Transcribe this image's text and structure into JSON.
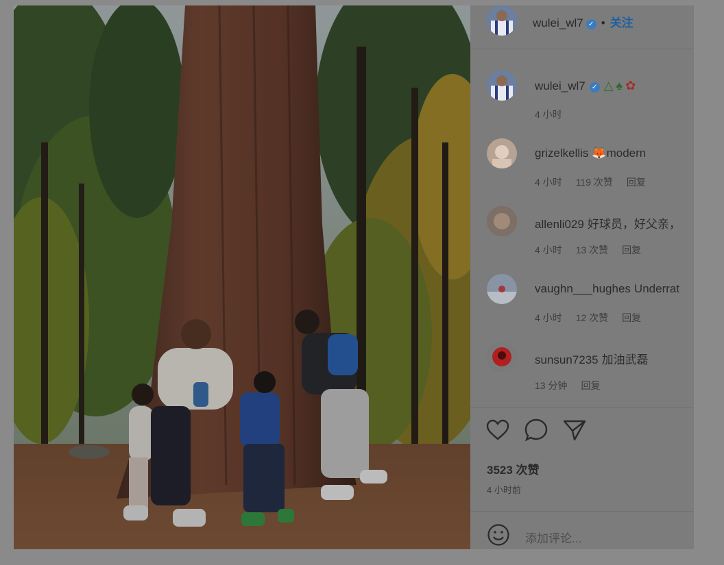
{
  "post": {
    "author": "wulei_wl7",
    "follow_label": "关注",
    "separator": "•",
    "caption_time": "4 小时",
    "caption_emojis": [
      "△",
      "♠",
      "✿"
    ],
    "likes": "3523 次赞",
    "posted_ago": "4 小时前",
    "add_comment_placeholder": "添加评论..."
  },
  "comments": [
    {
      "user": "grizelkellis",
      "text": "🦊modern",
      "time": "4 小时",
      "likes": "119 次赞",
      "reply": "回复"
    },
    {
      "user": "allenli029",
      "text": "好球员，好父亲，",
      "time": "4 小时",
      "likes": "13 次赞",
      "reply": "回复"
    },
    {
      "user": "vaughn___hughes",
      "text": "Underrat",
      "time": "4 小时",
      "likes": "12 次赞",
      "reply": "回复"
    },
    {
      "user": "sunsun7235",
      "text": "加油武磊",
      "time": "13 分钟",
      "likes": "",
      "reply": "回复"
    }
  ],
  "colors": {
    "overlay": "#8a8a8a",
    "panel": "#7c7c7c",
    "verified": "#3b7bbf",
    "follow": "#1d5fa0"
  },
  "icons": [
    "heart-icon",
    "comment-icon",
    "share-icon",
    "smile-icon",
    "verified-icon"
  ]
}
